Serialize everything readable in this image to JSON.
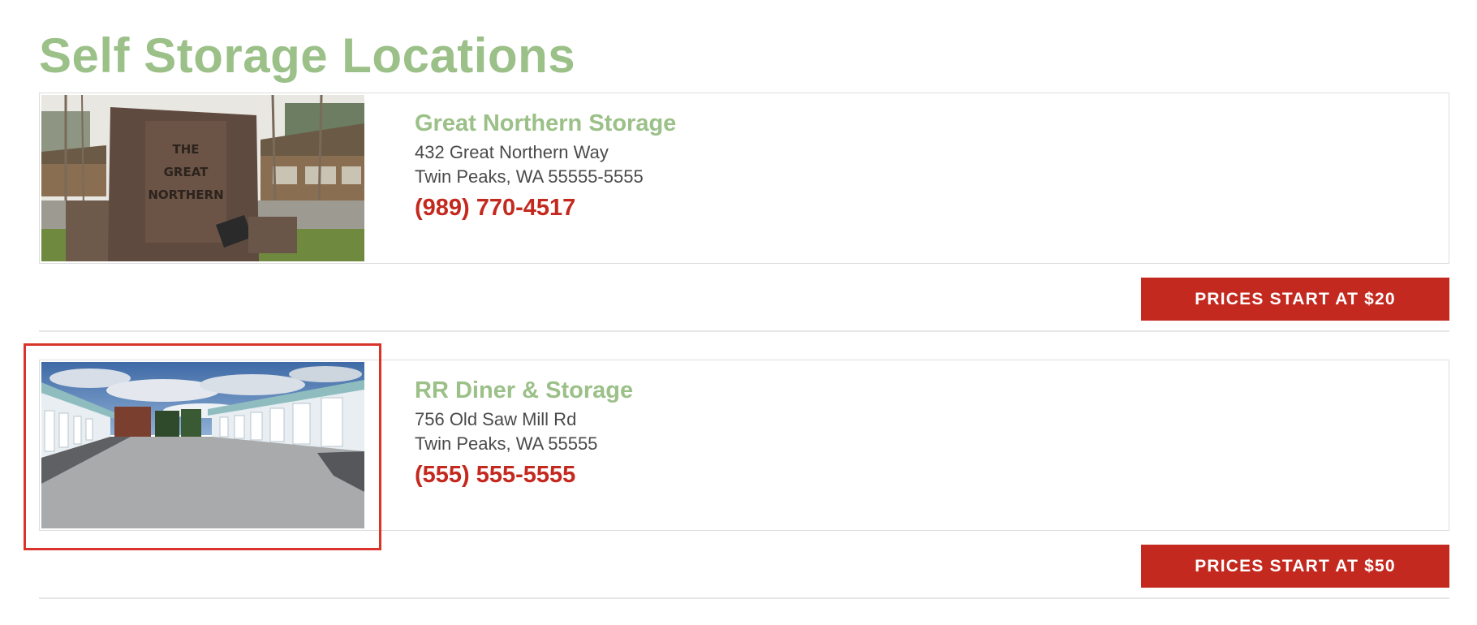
{
  "page": {
    "title": "Self Storage Locations"
  },
  "locations": [
    {
      "name": "Great Northern Storage",
      "address_line1": "432 Great Northern Way",
      "address_line2": "Twin Peaks, WA 55555-5555",
      "phone": "(989) 770-4517",
      "price_label": "PRICES START AT $20",
      "photo_sign_text": [
        "THE",
        "GREAT",
        "NORTHERN"
      ]
    },
    {
      "name": "RR Diner & Storage",
      "address_line1": "756 Old Saw Mill Rd",
      "address_line2": "Twin Peaks, WA 55555",
      "phone": "(555) 555-5555",
      "price_label": "PRICES START AT $50"
    }
  ],
  "colors": {
    "brand_green": "#9bc088",
    "accent_red": "#c4291f",
    "text_gray": "#4a4a4a",
    "border_gray": "#dddddd",
    "highlight_red": "#d8342b"
  }
}
